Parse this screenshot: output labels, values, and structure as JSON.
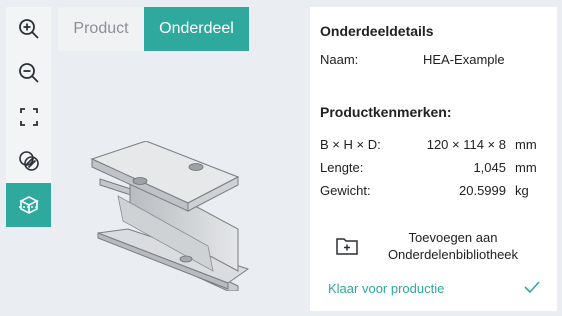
{
  "tabs": {
    "product": "Product",
    "part": "Onderdeel",
    "active": "part"
  },
  "toolbar": {
    "items": [
      {
        "icon": "zoom-in-icon"
      },
      {
        "icon": "zoom-out-icon"
      },
      {
        "icon": "fit-to-screen-icon"
      },
      {
        "icon": "layers-icon"
      },
      {
        "icon": "3d-box-icon",
        "active": true
      }
    ]
  },
  "details": {
    "title": "Onderdeeldetails",
    "name_label": "Naam:",
    "name_value": "HEA-Example"
  },
  "characteristics": {
    "title": "Productkenmerken:",
    "rows": [
      {
        "label": "B × H × D:",
        "value": "120 × 114 × 8",
        "unit": "mm"
      },
      {
        "label": "Lengte:",
        "value": "1,045",
        "unit": "mm"
      },
      {
        "label": "Gewicht:",
        "value": "20.5999",
        "unit": "kg"
      }
    ]
  },
  "actions": {
    "add_label": "Toevoegen aan Onderdelenbibliotheek",
    "status": "Klaar voor productie"
  },
  "colors": {
    "accent": "#2fa99e",
    "background": "#eaedf1",
    "panel": "#ffffff"
  }
}
